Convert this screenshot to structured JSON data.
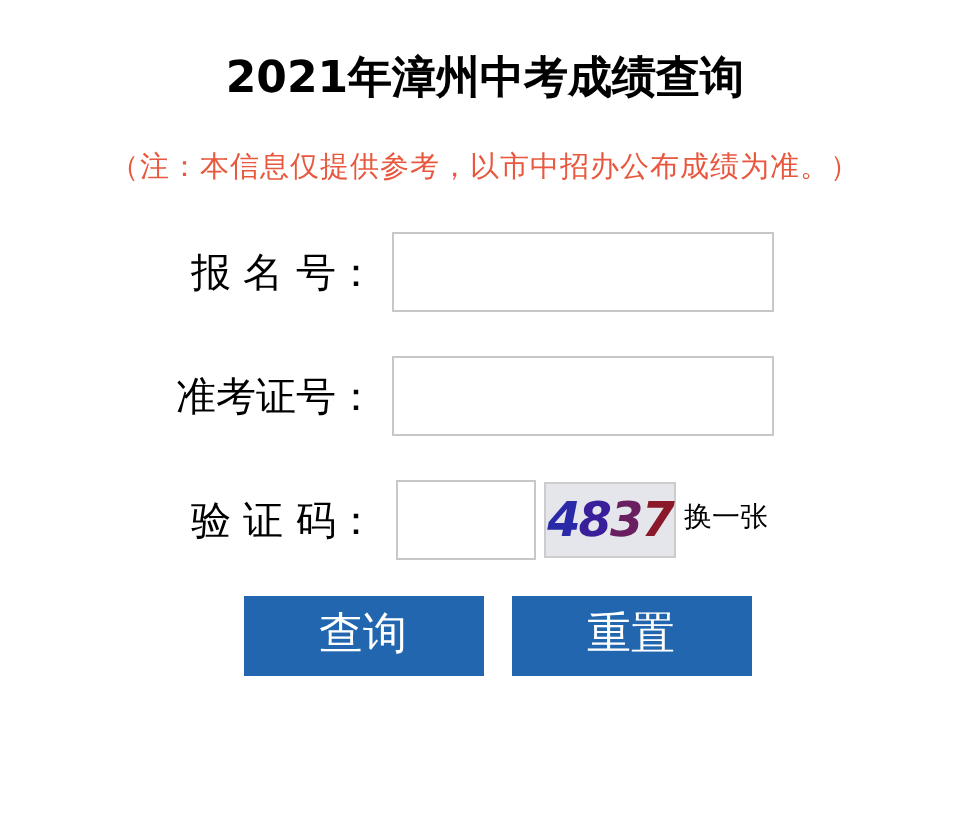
{
  "title": "2021年漳州中考成绩查询",
  "note": "（注：本信息仅提供参考，以市中招办公布成绩为准。）",
  "fields": [
    {
      "label": "报 名 号：",
      "kind": "text"
    },
    {
      "label": "准考证号：",
      "kind": "text"
    },
    {
      "label": "验 证 码：",
      "kind": "captcha",
      "captcha": "4837",
      "refresh": "换一张"
    }
  ],
  "buttons": [
    "查询",
    "重置"
  ]
}
